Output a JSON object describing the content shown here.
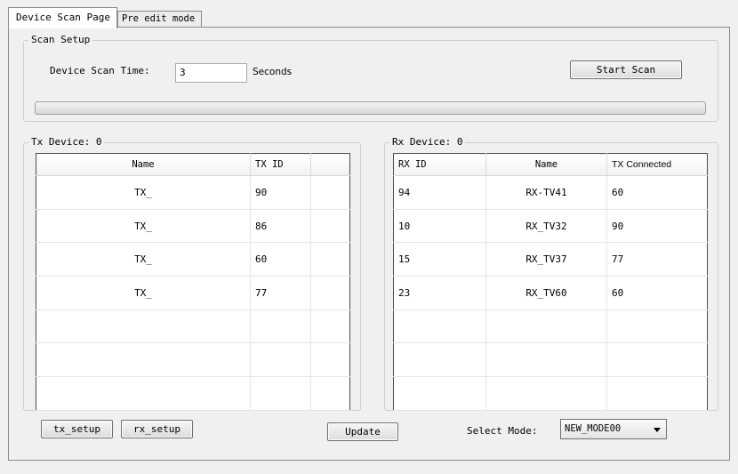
{
  "tabs": [
    {
      "label": "Device Scan Page"
    },
    {
      "label": "Pre edit mode"
    }
  ],
  "scan_setup": {
    "title": "Scan Setup",
    "time_label": "Device Scan Time:",
    "time_value": "3",
    "unit": "Seconds",
    "start_label": "Start Scan",
    "progress": 0
  },
  "tx": {
    "title": "Tx Device: 0",
    "columns": [
      "Name",
      "TX ID",
      ""
    ],
    "rows": [
      [
        "TX_",
        "90",
        ""
      ],
      [
        "TX_",
        "86",
        ""
      ],
      [
        "TX_",
        "60",
        ""
      ],
      [
        "TX_",
        "77",
        ""
      ],
      [
        "",
        "",
        ""
      ],
      [
        "",
        "",
        ""
      ],
      [
        "",
        "",
        ""
      ]
    ]
  },
  "rx": {
    "title": "Rx Device: 0",
    "columns": [
      "RX ID",
      "Name",
      "TX Connected"
    ],
    "rows": [
      [
        "94",
        "RX-TV41",
        "60"
      ],
      [
        "10",
        "RX_TV32",
        "90"
      ],
      [
        "15",
        "RX_TV37",
        "77"
      ],
      [
        "23",
        "RX_TV60",
        "60"
      ],
      [
        "",
        "",
        ""
      ],
      [
        "",
        "",
        ""
      ],
      [
        "",
        "",
        ""
      ]
    ]
  },
  "bottom": {
    "tx_setup": "tx_setup",
    "rx_setup": "rx_setup",
    "update": "Update",
    "select_mode_label": "Select Mode:",
    "select_mode_value": "NEW_MODE00"
  }
}
